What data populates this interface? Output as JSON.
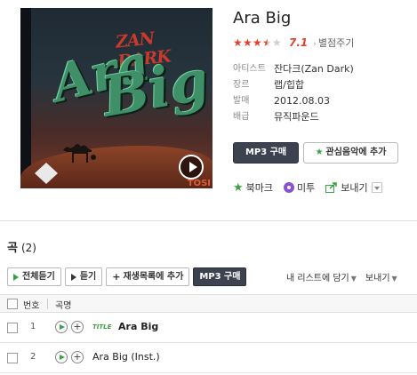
{
  "album": {
    "title": "Ara Big",
    "cover_text_top": "ZAN DARK",
    "cover_text_word1": "Ara",
    "cover_text_word2": "Big",
    "cover_text_corner": "TOSI",
    "rating_value": 7.1,
    "rating_stars_filled": 3.5,
    "rating_stars_total": 5,
    "score_label": "7.1",
    "rate_link": "별점주기",
    "info": [
      {
        "label": "아티스트",
        "value": "잔다크(Zan Dark)"
      },
      {
        "label": "장르",
        "value": "랩/힙합"
      },
      {
        "label": "발매",
        "value": "2012.08.03"
      },
      {
        "label": "배급",
        "value": "뮤직파운드"
      }
    ],
    "buy_mp3": "MP3 구매",
    "add_fav": "관심음악에 추가",
    "social": {
      "bookmark": "북마크",
      "metoo": "미투",
      "send": "보내기"
    }
  },
  "tracks_section": {
    "title": "곡",
    "count": "(2)",
    "toolbar": {
      "play_all": "전체듣기",
      "play": "듣기",
      "add_playlist": "재생목록에 추가",
      "buy_mp3": "MP3 구매",
      "my_list": "내 리스트에 담기",
      "send": "보내기"
    },
    "headers": {
      "no": "번호",
      "name": "곡명"
    },
    "tracks": [
      {
        "no": "1",
        "badge": "TITLE",
        "name": "Ara Big"
      },
      {
        "no": "2",
        "badge": "",
        "name": "Ara Big (Inst.)"
      }
    ]
  },
  "colors": {
    "accent_red": "#e0412f",
    "accent_green": "#3aa043",
    "dark_button": "#3d4250"
  }
}
